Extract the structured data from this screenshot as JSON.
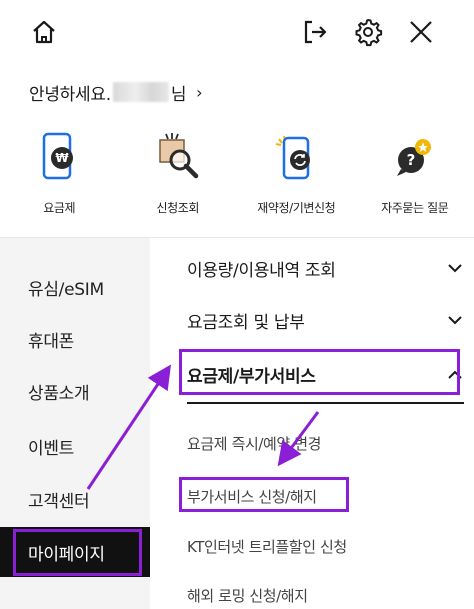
{
  "greeting": {
    "prefix": "안녕하세요.",
    "suffix": "님",
    "chevron": "›"
  },
  "topbar": {
    "icons": [
      "home-icon",
      "logout-icon",
      "gear-icon",
      "close-icon"
    ]
  },
  "shortcuts": [
    {
      "label": "요금제",
      "icon": "phone-won-icon"
    },
    {
      "label": "신청조회",
      "icon": "box-search-icon"
    },
    {
      "label": "재약정/기변신청",
      "icon": "phone-refresh-icon"
    },
    {
      "label": "자주묻는 질문",
      "icon": "question-bubble-icon"
    }
  ],
  "leftnav": {
    "items": [
      "유심/eSIM",
      "휴대폰",
      "상품소개",
      "이벤트",
      "고객센터",
      "마이페이지"
    ],
    "active": "마이페이지"
  },
  "rightpanel": {
    "menus": [
      {
        "label": "이용량/이용내역 조회",
        "state": "collapsed"
      },
      {
        "label": "요금조회 및 납부",
        "state": "collapsed"
      },
      {
        "label": "요금제/부가서비스",
        "state": "expanded"
      }
    ],
    "subitems": [
      "요금제 즉시/예약 변경",
      "부가서비스 신청/해지",
      "KT인터넷 트리플할인 신청",
      "해외 로밍 신청/해지"
    ]
  },
  "colors": {
    "highlight": "#8a1fd6",
    "active_nav_bg": "#111111",
    "nav_bg": "#f4f4f4",
    "icon_blue": "#1f6fe0",
    "icon_dark": "#2b2b2b",
    "icon_yellow": "#f2b705"
  }
}
